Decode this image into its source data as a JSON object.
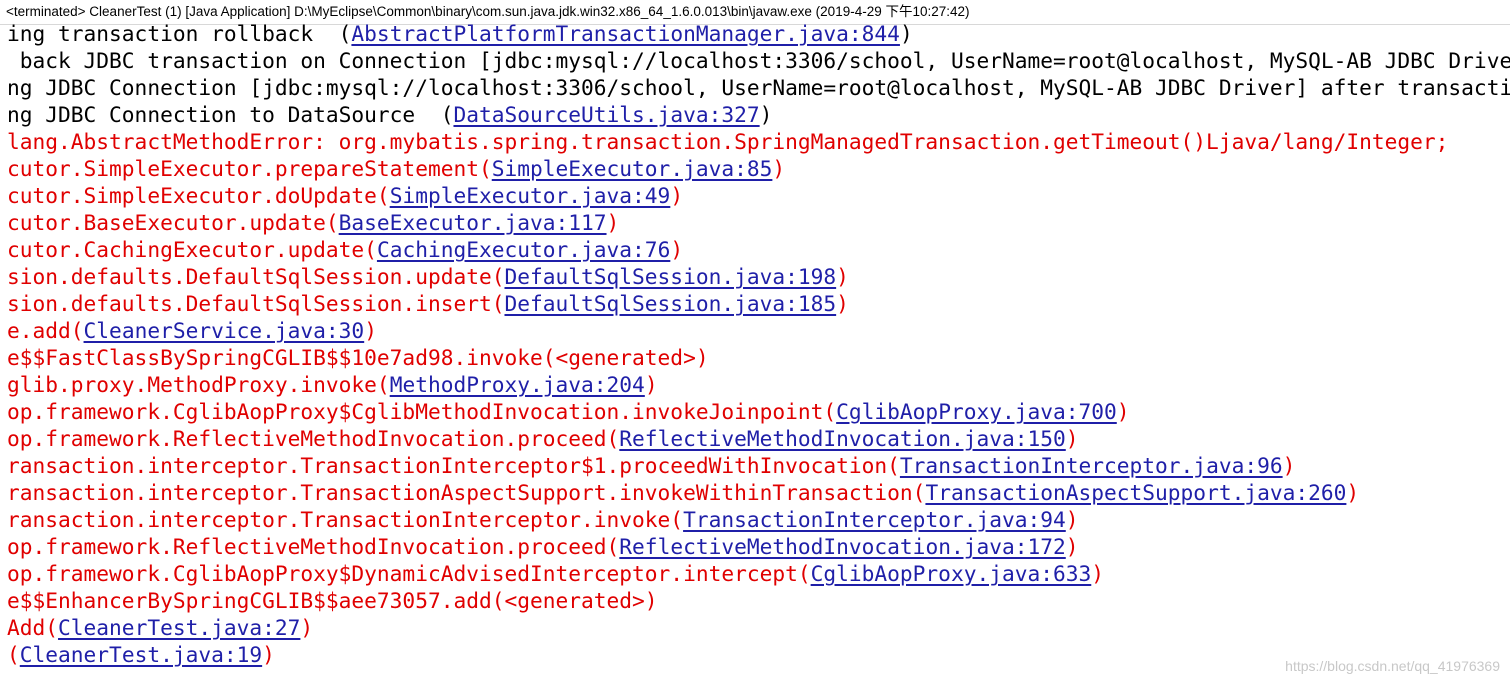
{
  "console": {
    "header": "<terminated> CleanerTest (1) [Java Application] D:\\MyEclipse\\Common\\binary\\com.sun.java.jdk.win32.x86_64_1.6.0.013\\bin\\javaw.exe (2019-4-29 下午10:27:42)",
    "watermark": "https://blog.csdn.net/qq_41976369",
    "colors": {
      "normal_text": "#000000",
      "error_text": "#e00000",
      "link_text": "#1f1fa8",
      "background": "#ffffff"
    },
    "lines": [
      {
        "style": "black",
        "pre": "ing transaction rollback  (",
        "link": "AbstractPlatformTransactionManager.java:844",
        "post": ")"
      },
      {
        "style": "black",
        "pre": " back JDBC transaction on Connection [jdbc:mysql://localhost:3306/school, UserName=root@localhost, MySQL-AB JDBC Driver]",
        "link": "",
        "post": ""
      },
      {
        "style": "black",
        "pre": "ng JDBC Connection [jdbc:mysql://localhost:3306/school, UserName=root@localhost, MySQL-AB JDBC Driver] after transaction",
        "link": "",
        "post": ""
      },
      {
        "style": "black",
        "pre": "ng JDBC Connection to DataSource  (",
        "link": "DataSourceUtils.java:327",
        "post": ")"
      },
      {
        "style": "red",
        "pre": "lang.AbstractMethodError: org.mybatis.spring.transaction.SpringManagedTransaction.getTimeout()Ljava/lang/Integer;",
        "link": "",
        "post": ""
      },
      {
        "style": "red",
        "pre": "cutor.SimpleExecutor.prepareStatement(",
        "link": "SimpleExecutor.java:85",
        "post": ")"
      },
      {
        "style": "red",
        "pre": "cutor.SimpleExecutor.doUpdate(",
        "link": "SimpleExecutor.java:49",
        "post": ")"
      },
      {
        "style": "red",
        "pre": "cutor.BaseExecutor.update(",
        "link": "BaseExecutor.java:117",
        "post": ")"
      },
      {
        "style": "red",
        "pre": "cutor.CachingExecutor.update(",
        "link": "CachingExecutor.java:76",
        "post": ")"
      },
      {
        "style": "red",
        "pre": "sion.defaults.DefaultSqlSession.update(",
        "link": "DefaultSqlSession.java:198",
        "post": ")"
      },
      {
        "style": "red",
        "pre": "sion.defaults.DefaultSqlSession.insert(",
        "link": "DefaultSqlSession.java:185",
        "post": ")"
      },
      {
        "style": "red",
        "pre": "e.add(",
        "link": "CleanerService.java:30",
        "post": ")"
      },
      {
        "style": "red",
        "pre": "e$$FastClassBySpringCGLIB$$10e7ad98.invoke(<generated>)",
        "link": "",
        "post": ""
      },
      {
        "style": "red",
        "pre": "glib.proxy.MethodProxy.invoke(",
        "link": "MethodProxy.java:204",
        "post": ")"
      },
      {
        "style": "red",
        "pre": "op.framework.CglibAopProxy$CglibMethodInvocation.invokeJoinpoint(",
        "link": "CglibAopProxy.java:700",
        "post": ")"
      },
      {
        "style": "red",
        "pre": "op.framework.ReflectiveMethodInvocation.proceed(",
        "link": "ReflectiveMethodInvocation.java:150",
        "post": ")"
      },
      {
        "style": "red",
        "pre": "ransaction.interceptor.TransactionInterceptor$1.proceedWithInvocation(",
        "link": "TransactionInterceptor.java:96",
        "post": ")"
      },
      {
        "style": "red",
        "pre": "ransaction.interceptor.TransactionAspectSupport.invokeWithinTransaction(",
        "link": "TransactionAspectSupport.java:260",
        "post": ")"
      },
      {
        "style": "red",
        "pre": "ransaction.interceptor.TransactionInterceptor.invoke(",
        "link": "TransactionInterceptor.java:94",
        "post": ")"
      },
      {
        "style": "red",
        "pre": "op.framework.ReflectiveMethodInvocation.proceed(",
        "link": "ReflectiveMethodInvocation.java:172",
        "post": ")"
      },
      {
        "style": "red",
        "pre": "op.framework.CglibAopProxy$DynamicAdvisedInterceptor.intercept(",
        "link": "CglibAopProxy.java:633",
        "post": ")"
      },
      {
        "style": "red",
        "pre": "e$$EnhancerBySpringCGLIB$$aee73057.add(<generated>)",
        "link": "",
        "post": ""
      },
      {
        "style": "red",
        "pre": "Add(",
        "link": "CleanerTest.java:27",
        "post": ")"
      },
      {
        "style": "red",
        "pre": "(",
        "link": "CleanerTest.java:19",
        "post": ")"
      }
    ]
  }
}
